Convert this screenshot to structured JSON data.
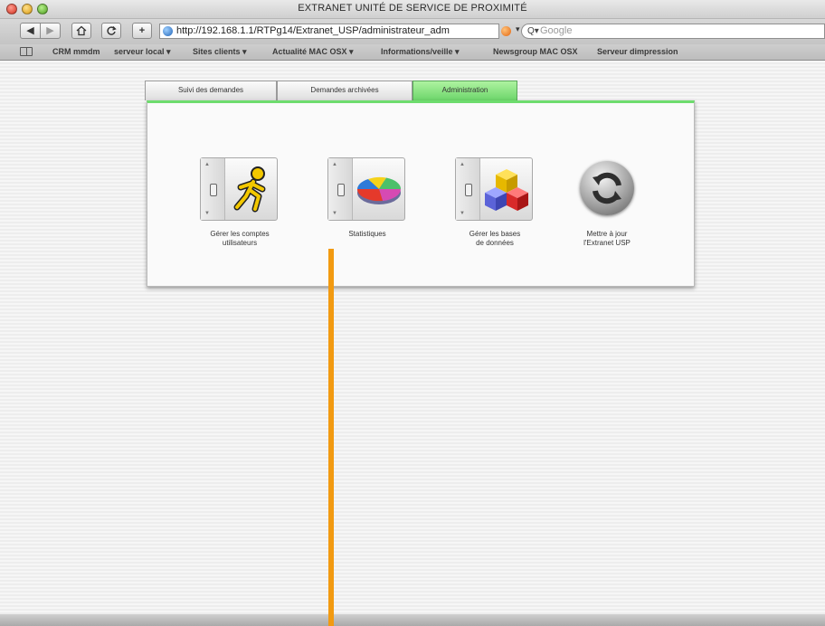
{
  "window": {
    "title": "EXTRANET UNITÉ DE SERVICE DE PROXIMITÉ"
  },
  "toolbar": {
    "url": "http://192.168.1.1/RTPg14/Extranet_USP/administrateur_adm",
    "search_placeholder": "Google",
    "add_label": "+"
  },
  "bookmarks": [
    {
      "label": "CRM mmdm"
    },
    {
      "label": "serveur local ▾"
    },
    {
      "label": "Sites clients ▾"
    },
    {
      "label": "Actualité MAC OSX ▾"
    },
    {
      "label": "Informations/veille ▾"
    },
    {
      "label": "Newsgroup MAC OSX"
    },
    {
      "label": "Serveur dimpression"
    }
  ],
  "tabs": [
    {
      "label": "Suivi des demandes"
    },
    {
      "label": "Demandes archivées"
    },
    {
      "label": "Administration"
    }
  ],
  "tiles": [
    {
      "label_line1": "Gérer les comptes",
      "label_line2": "utilisateurs",
      "icon": "running-person-icon"
    },
    {
      "label_line1": "Statistiques",
      "label_line2": "",
      "icon": "pie-chart-icon"
    },
    {
      "label_line1": "Gérer les bases",
      "label_line2": "de données",
      "icon": "cubes-icon"
    },
    {
      "label_line1": "Mettre à jour",
      "label_line2": "l'Extranet USP",
      "icon": "sync-icon"
    }
  ],
  "colors": {
    "active_tab": "#6cd56a",
    "annotation": "#f29a11"
  }
}
